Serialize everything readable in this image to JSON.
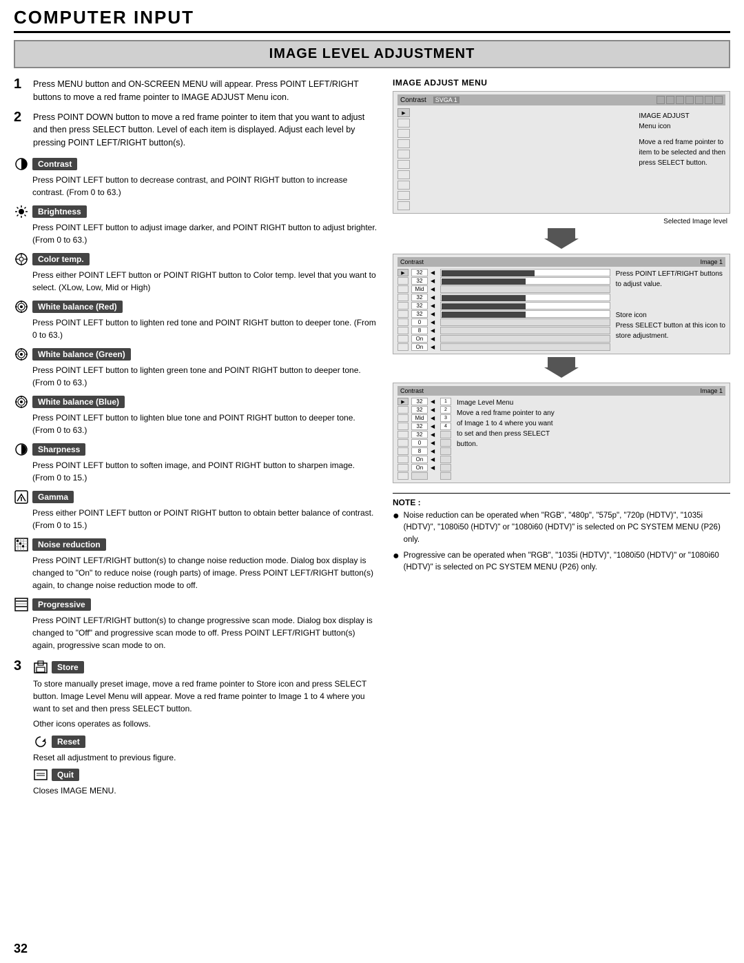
{
  "page": {
    "number": "32",
    "chapter_title": "COMPUTER INPUT",
    "section_title": "IMAGE LEVEL ADJUSTMENT"
  },
  "steps": {
    "step1_number": "1",
    "step1_text": "Press MENU button and ON-SCREEN MENU will appear.  Press POINT LEFT/RIGHT buttons to move a red frame pointer to IMAGE ADJUST Menu icon.",
    "step2_number": "2",
    "step2_text": "Press POINT DOWN button to move a red frame pointer to item that you want to adjust and then press SELECT button. Level of each item is displayed.  Adjust each level by pressing POINT LEFT/RIGHT button(s).",
    "step3_number": "3"
  },
  "features": [
    {
      "id": "contrast",
      "label": "Contrast",
      "icon": "contrast-icon",
      "desc": "Press POINT LEFT button to decrease contrast, and POINT RIGHT button to increase contrast.  (From 0 to 63.)"
    },
    {
      "id": "brightness",
      "label": "Brightness",
      "icon": "brightness-icon",
      "desc": "Press POINT LEFT button to adjust image darker, and POINT RIGHT button to adjust brighter.  (From 0 to 63.)"
    },
    {
      "id": "colortemp",
      "label": "Color temp.",
      "icon": "colortemp-icon",
      "desc": "Press either POINT LEFT button or POINT RIGHT button to Color temp. level that you want to select.  (XLow, Low, Mid or High)"
    },
    {
      "id": "wbred",
      "label": "White balance (Red)",
      "icon": "wbred-icon",
      "desc": "Press POINT LEFT button to lighten red tone and POINT RIGHT button to deeper tone.  (From 0 to 63.)"
    },
    {
      "id": "wbgreen",
      "label": "White balance (Green)",
      "icon": "wbgreen-icon",
      "desc": "Press POINT LEFT button to lighten green tone and POINT RIGHT button to deeper tone.  (From 0 to 63.)"
    },
    {
      "id": "wbblue",
      "label": "White balance (Blue)",
      "icon": "wbblue-icon",
      "desc": "Press POINT LEFT button to lighten blue tone and POINT RIGHT button to deeper tone.  (From 0 to 63.)"
    },
    {
      "id": "sharpness",
      "label": "Sharpness",
      "icon": "sharpness-icon",
      "desc": "Press POINT LEFT button to soften image, and POINT RIGHT button to sharpen image.  (From 0 to 15.)"
    },
    {
      "id": "gamma",
      "label": "Gamma",
      "icon": "gamma-icon",
      "desc": "Press either POINT LEFT button or POINT RIGHT button to obtain better balance of contrast.  (From 0 to 15.)"
    },
    {
      "id": "noisereduction",
      "label": "Noise reduction",
      "icon": "noise-icon",
      "desc": "Press POINT LEFT/RIGHT button(s) to change noise reduction mode.  Dialog box display is changed to \"On\" to reduce noise (rough parts)  of  image.  Press POINT LEFT/RIGHT button(s) again, to change noise reduction mode to off."
    },
    {
      "id": "progressive",
      "label": "Progressive",
      "icon": "progressive-icon",
      "desc": "Press POINT LEFT/RIGHT button(s) to change progressive scan mode. Dialog box display is changed to \"Off\" and progressive scan mode to off. Press POINT LEFT/RIGHT button(s) again, progressive scan mode to on."
    }
  ],
  "store": {
    "label": "Store",
    "desc": "To store manually preset image, move a red frame pointer to Store icon and press SELECT button.  Image Level Menu will appear.  Move a red frame pointer to Image 1 to 4 where you want to set and then press SELECT button.",
    "other_icons_text": "Other icons operates as follows."
  },
  "reset": {
    "label": "Reset",
    "desc": "Reset all adjustment to previous figure."
  },
  "quit": {
    "label": "Quit",
    "desc": "Closes IMAGE MENU."
  },
  "right_panel": {
    "menu_title": "IMAGE ADJUST MENU",
    "topbar_text": "Contrast",
    "topbar_right": "SVGA 1",
    "annot1": "IMAGE ADJUST",
    "annot2": "Menu icon",
    "annot3": "Move a red frame pointer to",
    "annot4": "item to be selected and then",
    "annot5": "press SELECT button.",
    "selected_label": "Selected Image level",
    "diag2_left": "Contrast",
    "diag2_right": "Image 1",
    "annot_adjust": "Press POINT LEFT/RIGHT buttons",
    "annot_adjust2": "to adjust value.",
    "store_label": "Store icon",
    "store_annot1": "Press SELECT button at this icon to",
    "store_annot2": "store adjustment.",
    "diag3_left": "Contrast",
    "diag3_right": "Image 1",
    "image_level_annot1": "Image Level Menu",
    "image_level_annot2": "Move a red frame pointer to any",
    "image_level_annot3": "of Image 1 to 4 where you want",
    "image_level_annot4": "to set  and then press SELECT",
    "image_level_annot5": "button."
  },
  "notes": {
    "title": "NOTE :",
    "items": [
      "Noise reduction can be operated when  \"RGB\", \"480p\", \"575p\", \"720p (HDTV)\", \"1035i (HDTV)\", \"1080i50 (HDTV)\" or \"1080i60 (HDTV)\" is selected on PC SYSTEM MENU (P26) only.",
      "Progressive can be operated when  \"RGB\", \"1035i (HDTV)\", \"1080i50 (HDTV)\" or \"1080i60 (HDTV)\" is selected on PC SYSTEM MENU (P26) only."
    ]
  },
  "diag": {
    "rows": [
      {
        "val": "32"
      },
      {
        "val": "32"
      },
      {
        "val": "Mid"
      },
      {
        "val": "32"
      },
      {
        "val": "32"
      },
      {
        "val": "32"
      },
      {
        "val": "0"
      },
      {
        "val": "8"
      },
      {
        "val": "On"
      },
      {
        "val": "On"
      }
    ]
  }
}
